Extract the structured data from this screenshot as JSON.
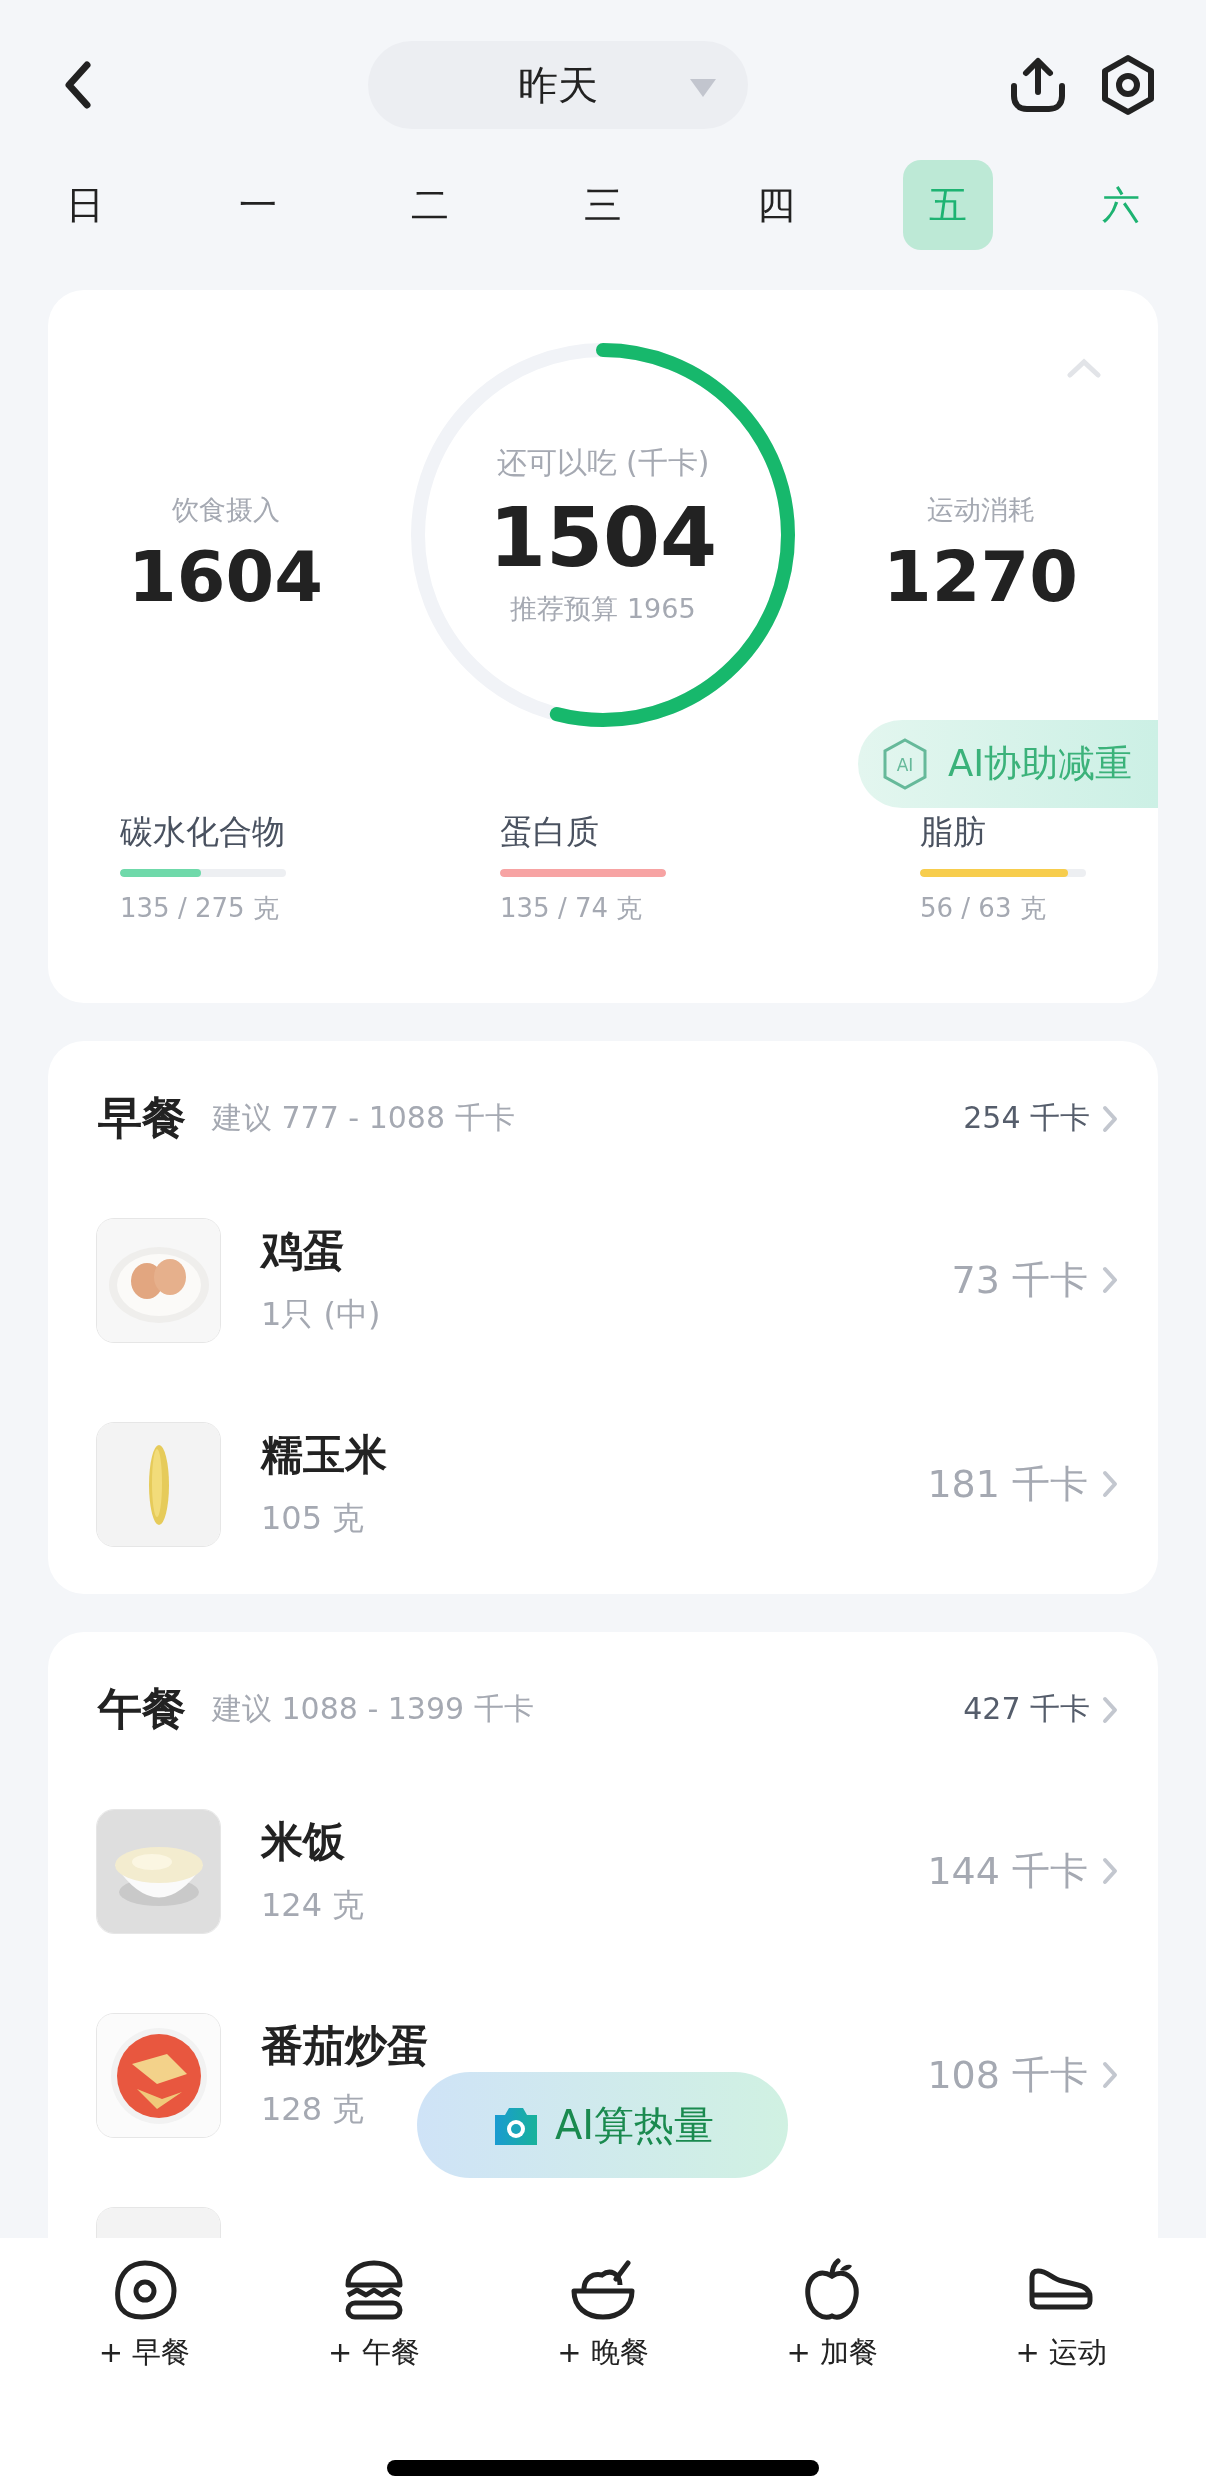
{
  "header": {
    "date": "昨天"
  },
  "weekdays": [
    {
      "label": "日",
      "selected": false,
      "today": false
    },
    {
      "label": "一",
      "selected": false,
      "today": false
    },
    {
      "label": "二",
      "selected": false,
      "today": false
    },
    {
      "label": "三",
      "selected": false,
      "today": false
    },
    {
      "label": "四",
      "selected": false,
      "today": false
    },
    {
      "label": "五",
      "selected": true,
      "today": false
    },
    {
      "label": "六",
      "selected": false,
      "today": true
    }
  ],
  "summary": {
    "intake": {
      "label": "饮食摄入",
      "value": "1604"
    },
    "remaining": {
      "label": "还可以吃 (千卡)",
      "value": "1504",
      "budget": "推荐预算 1965",
      "level": 0.54
    },
    "burned": {
      "label": "运动消耗",
      "value": "1270"
    },
    "ai_button": "AI协助减重",
    "ai_badge": "AI",
    "macros": [
      {
        "name": "碳水化合物",
        "value": "135 / 275 克",
        "level": 0.49,
        "color": "#6fd9aa"
      },
      {
        "name": "蛋白质",
        "value": "135 / 74 克",
        "level": 1,
        "color": "#f7a3a3"
      },
      {
        "name": "脂肪",
        "value": "56 / 63 克",
        "level": 0.89,
        "color": "#f7cd4d"
      }
    ]
  },
  "meals": [
    {
      "title": "早餐",
      "suggestion": "建议 777 - 1088 千卡",
      "total": "254 千卡",
      "cut_row": false,
      "items": [
        {
          "name": "鸡蛋",
          "amount": "1只 (中)",
          "calories": "73 千卡"
        },
        {
          "name": "糯玉米",
          "amount": "105 克",
          "calories": "181 千卡"
        }
      ]
    },
    {
      "title": "午餐",
      "suggestion": "建议 1088 - 1399 千卡",
      "total": "427 千卡",
      "cut_row": true,
      "items": [
        {
          "name": "米饭",
          "amount": "124 克",
          "calories": "144 千卡"
        },
        {
          "name": "番茄炒蛋",
          "amount": "128 克",
          "calories": "108 千卡"
        }
      ]
    }
  ],
  "ai_calc_button": "AI算热量",
  "bottom_nav": [
    {
      "label": "+ 早餐"
    },
    {
      "label": "+ 午餐"
    },
    {
      "label": "+ 晚餐"
    },
    {
      "label": "+ 加餐"
    },
    {
      "label": "+ 运动"
    }
  ]
}
